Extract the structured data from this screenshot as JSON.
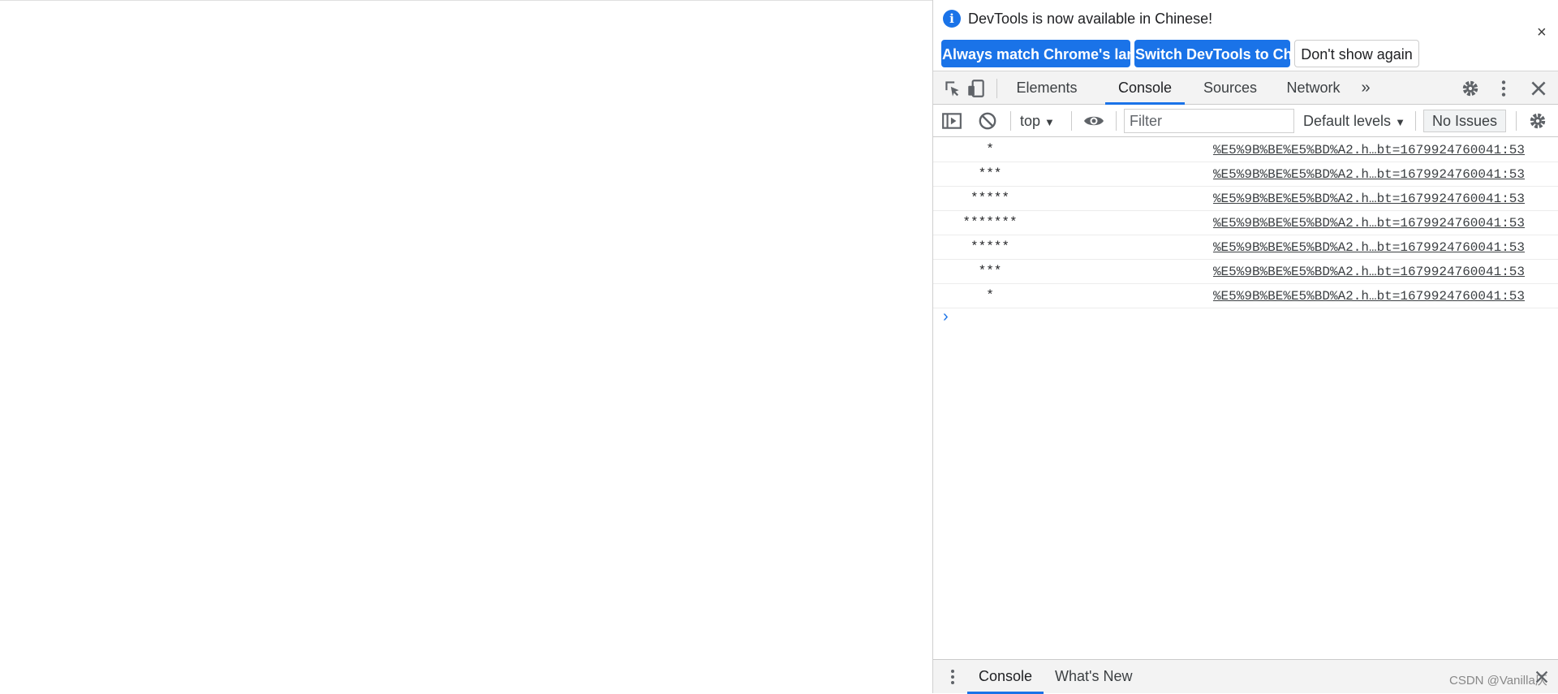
{
  "infobar": {
    "message": "DevTools is now available in Chinese!",
    "buttons": [
      "Always match Chrome's language",
      "Switch DevTools to Chinese",
      "Don't show again"
    ],
    "close_glyph": "×"
  },
  "tabs": [
    "Elements",
    "Console",
    "Sources",
    "Network"
  ],
  "active_tab": "Console",
  "more_tabs_glyph": "»",
  "console_toolbar": {
    "context": "top",
    "filter_placeholder": "Filter",
    "levels": "Default levels",
    "issues": "No Issues"
  },
  "messages": [
    {
      "text": "*",
      "source": "%E5%9B%BE%E5%BD%A2.h…bt=1679924760041:53"
    },
    {
      "text": "***",
      "source": "%E5%9B%BE%E5%BD%A2.h…bt=1679924760041:53"
    },
    {
      "text": "*****",
      "source": "%E5%9B%BE%E5%BD%A2.h…bt=1679924760041:53"
    },
    {
      "text": "*******",
      "source": "%E5%9B%BE%E5%BD%A2.h…bt=1679924760041:53"
    },
    {
      "text": "*****",
      "source": "%E5%9B%BE%E5%BD%A2.h…bt=1679924760041:53"
    },
    {
      "text": "***",
      "source": "%E5%9B%BE%E5%BD%A2.h…bt=1679924760041:53"
    },
    {
      "text": "*",
      "source": "%E5%9B%BE%E5%BD%A2.h…bt=1679924760041:53"
    }
  ],
  "prompt_glyph": "›",
  "drawer": {
    "tabs": [
      "Console",
      "What's New"
    ],
    "active_tab": "Console"
  },
  "watermark": "CSDN @Vanilla仄"
}
